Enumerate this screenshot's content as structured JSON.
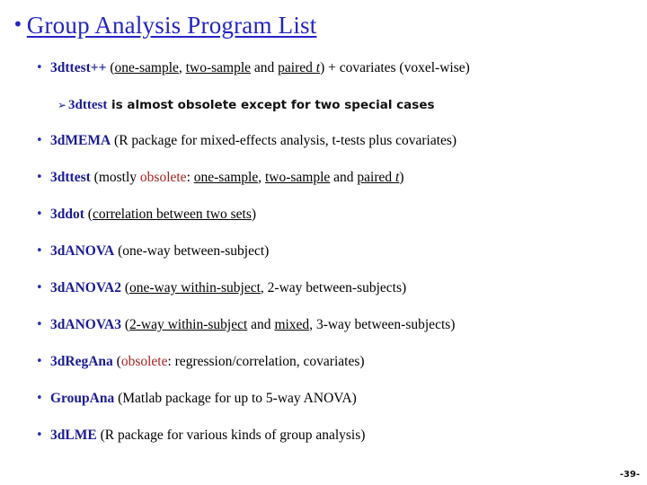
{
  "slide": {
    "title": "Group Analysis Program List",
    "title_bullet": "bullet-dot",
    "page_number": "-39-",
    "colors": {
      "title_blue": "#2323c8",
      "program_blue": "#1b1b96",
      "obsolete_red": "#a82222",
      "body_black": "#000000",
      "background": "#ffffff"
    }
  },
  "items": [
    {
      "bullet": "bullet-dot",
      "program": "3dttest++",
      "parts": [
        {
          "text": " (",
          "style": "plain"
        },
        {
          "text": "one-sample",
          "style": "underline"
        },
        {
          "text": ", ",
          "style": "plain"
        },
        {
          "text": "two-sample",
          "style": "underline"
        },
        {
          "text": " and ",
          "style": "plain"
        },
        {
          "text": "paired ",
          "style": "underline"
        },
        {
          "text": "t",
          "style": "underline-italic"
        },
        {
          "text": ") + covariates (voxel-wise)",
          "style": "plain"
        }
      ],
      "sub": {
        "bullet": "arrow-bullet",
        "program": "3dttest",
        "text": "is almost obsolete except for two special cases"
      }
    },
    {
      "bullet": "bullet-dot",
      "program": "3dMEMA",
      "parts": [
        {
          "text": " (R package for mixed-effects analysis, t-tests plus covariates)",
          "style": "plain"
        }
      ]
    },
    {
      "bullet": "bullet-dot",
      "program": "3dttest",
      "parts": [
        {
          "text": "  (mostly ",
          "style": "plain"
        },
        {
          "text": "obsolete",
          "style": "red"
        },
        {
          "text": ": ",
          "style": "plain"
        },
        {
          "text": "one-sample",
          "style": "underline"
        },
        {
          "text": ", ",
          "style": "plain"
        },
        {
          "text": "two-sample",
          "style": "underline"
        },
        {
          "text": " and ",
          "style": "plain"
        },
        {
          "text": "paired ",
          "style": "underline"
        },
        {
          "text": "t",
          "style": "underline-italic"
        },
        {
          "text": ")",
          "style": "plain"
        }
      ]
    },
    {
      "bullet": "bullet-dot",
      "program": "3ddot",
      "parts": [
        {
          "text": "  (",
          "style": "plain"
        },
        {
          "text": "correlation between two sets",
          "style": "underline"
        },
        {
          "text": ")",
          "style": "plain"
        }
      ]
    },
    {
      "bullet": "bullet-dot",
      "program": "3dANOVA",
      "parts": [
        {
          "text": " (one-way between-subject)",
          "style": "plain"
        }
      ]
    },
    {
      "bullet": "bullet-dot",
      "program": "3dANOVA2",
      "parts": [
        {
          "text": " (",
          "style": "plain"
        },
        {
          "text": "one-way within-subject",
          "style": "underline"
        },
        {
          "text": ", 2-way between-subjects)",
          "style": "plain"
        }
      ]
    },
    {
      "bullet": "bullet-dot",
      "program": "3dANOVA3",
      "parts": [
        {
          "text": " (",
          "style": "plain"
        },
        {
          "text": "2-way within-subject",
          "style": "underline"
        },
        {
          "text": " and ",
          "style": "plain"
        },
        {
          "text": "mixed",
          "style": "underline"
        },
        {
          "text": ", 3-way between-subjects)",
          "style": "plain"
        }
      ]
    },
    {
      "bullet": "bullet-dot",
      "program": "3dRegAna",
      "parts": [
        {
          "text": " (",
          "style": "plain"
        },
        {
          "text": "obsolete",
          "style": "red"
        },
        {
          "text": ": regression/correlation, covariates)",
          "style": "plain"
        }
      ]
    },
    {
      "bullet": "bullet-dot",
      "program": "GroupAna",
      "parts": [
        {
          "text": " (Matlab package for up to 5-way ANOVA)",
          "style": "plain"
        }
      ]
    },
    {
      "bullet": "bullet-dot",
      "program": "3dLME",
      "parts": [
        {
          "text": " (R package for various kinds of group analysis)",
          "style": "plain"
        }
      ]
    }
  ]
}
